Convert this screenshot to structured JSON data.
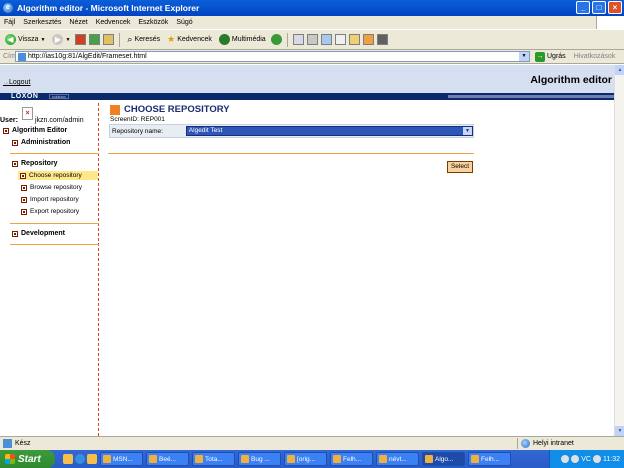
{
  "window": {
    "title": "Algorithm editor - Microsoft Internet Explorer"
  },
  "menu": [
    "Fájl",
    "Szerkesztés",
    "Nézet",
    "Kedvencek",
    "Eszközök",
    "Súgó"
  ],
  "toolbar": {
    "back": "Vissza",
    "search": "Keresés",
    "favorites": "Kedvencek",
    "media": "Multimédia"
  },
  "address": {
    "label": "Cím",
    "url": "http://ias10g:81/AlgEdit/Frameset.html",
    "go": "Ugrás",
    "links": "Hivatkozások"
  },
  "app": {
    "logout": "Logout",
    "title": "Algorithm editor",
    "brand": "LOXON",
    "brand_sub": "solutions",
    "user_label": "User:",
    "user_value": "jkzn.com/admin"
  },
  "nav": {
    "root": "Algorithm Editor",
    "administration": "Administration",
    "repository": "Repository",
    "repo_items": [
      "Choose repository",
      "Browse repository",
      "Import repository",
      "Export repository"
    ],
    "development": "Development"
  },
  "main": {
    "title": "CHOOSE REPOSITORY",
    "screen_id": "ScreenID: REP001",
    "repo_label": "Repository name:",
    "repo_value": "Algedit Test",
    "select_button": "Select"
  },
  "status": {
    "text": "Kész",
    "zone": "Helyi intranet"
  },
  "taskbar": {
    "start": "Start",
    "tasks": [
      "MSN...",
      "Beé...",
      "Tota...",
      "Bug ...",
      "[orig...",
      "Felh...",
      "névt...",
      "Algo...",
      "Felh..."
    ],
    "active_index": 7,
    "tray_lang": "VC",
    "clock": "11:32"
  }
}
